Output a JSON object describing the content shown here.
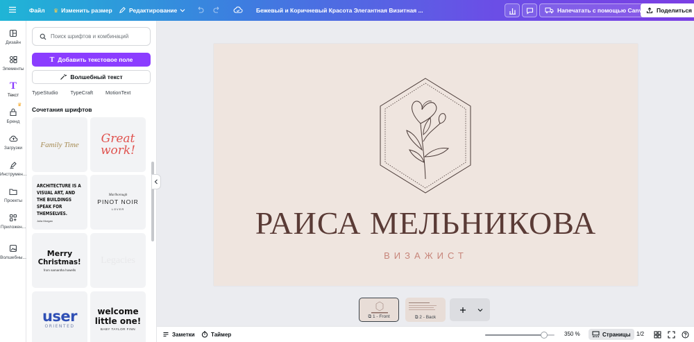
{
  "topbar": {
    "menu_icon": "hamburger-icon",
    "file_label": "Файл",
    "resize_label": "Изменить размер",
    "edit_label": "Редактирование",
    "doc_title": "Бежевый и Коричневый Красота Элегантная Визитная ...",
    "print_label": "Напечатать с помощью Canva",
    "share_label": "Поделиться"
  },
  "rail": {
    "items": [
      {
        "label": "Дизайн",
        "icon": "layout-icon"
      },
      {
        "label": "Элементы",
        "icon": "shapes-icon"
      },
      {
        "label": "Текст",
        "icon": "text-icon"
      },
      {
        "label": "Бренд",
        "icon": "brand-icon"
      },
      {
        "label": "Загрузки",
        "icon": "cloud-upload-icon"
      },
      {
        "label": "Инструмен...",
        "icon": "draw-icon"
      },
      {
        "label": "Проекты",
        "icon": "folder-icon"
      },
      {
        "label": "Приложен...",
        "icon": "apps-icon"
      },
      {
        "label": "Волшебны...",
        "icon": "magic-media-icon"
      }
    ]
  },
  "panel": {
    "search_placeholder": "Поиск шрифтов и комбинаций",
    "add_text_label": "Добавить текстовое поле",
    "magic_text_label": "Волшебный текст",
    "chips": [
      "TypeStudio",
      "TypeCraft",
      "MotionText"
    ],
    "section_title": "Сочетания шрифтов",
    "tiles": {
      "t1": "Family Time",
      "t2a": "Great",
      "t2b": "work!",
      "t3": "ARCHITECTURE IS A VISUAL ART, AND THE BUILDINGS SPEAK FOR THEMSELVES.",
      "t3sub": "Julia Morgan",
      "t4top": "Marlborough",
      "t4main": "PINOT NOIR",
      "t4sub": "LOVER",
      "t5a": "Merry",
      "t5b": "Christmas!",
      "t5sub": "from samantha howells",
      "t6": "Legacies",
      "t7a": "user",
      "t7b": "ORIENTED",
      "t8a": "welcome",
      "t8b": "little one!",
      "t8sub": "BABY TAYLOR FINN"
    }
  },
  "card": {
    "name": "РАИСА МЕЛЬНИКОВА",
    "role": "ВИЗАЖИСТ",
    "colors": {
      "background": "#efe5df",
      "name": "#5a3b36",
      "role": "#c7857a"
    }
  },
  "pages": [
    {
      "label": "1 - Front"
    },
    {
      "label": "2 - Back"
    }
  ],
  "bottombar": {
    "notes_label": "Заметки",
    "timer_label": "Таймер",
    "zoom_label": "350 %",
    "zoom_level": 0.85,
    "pages_label": "Страницы",
    "page_count": "1/2"
  }
}
